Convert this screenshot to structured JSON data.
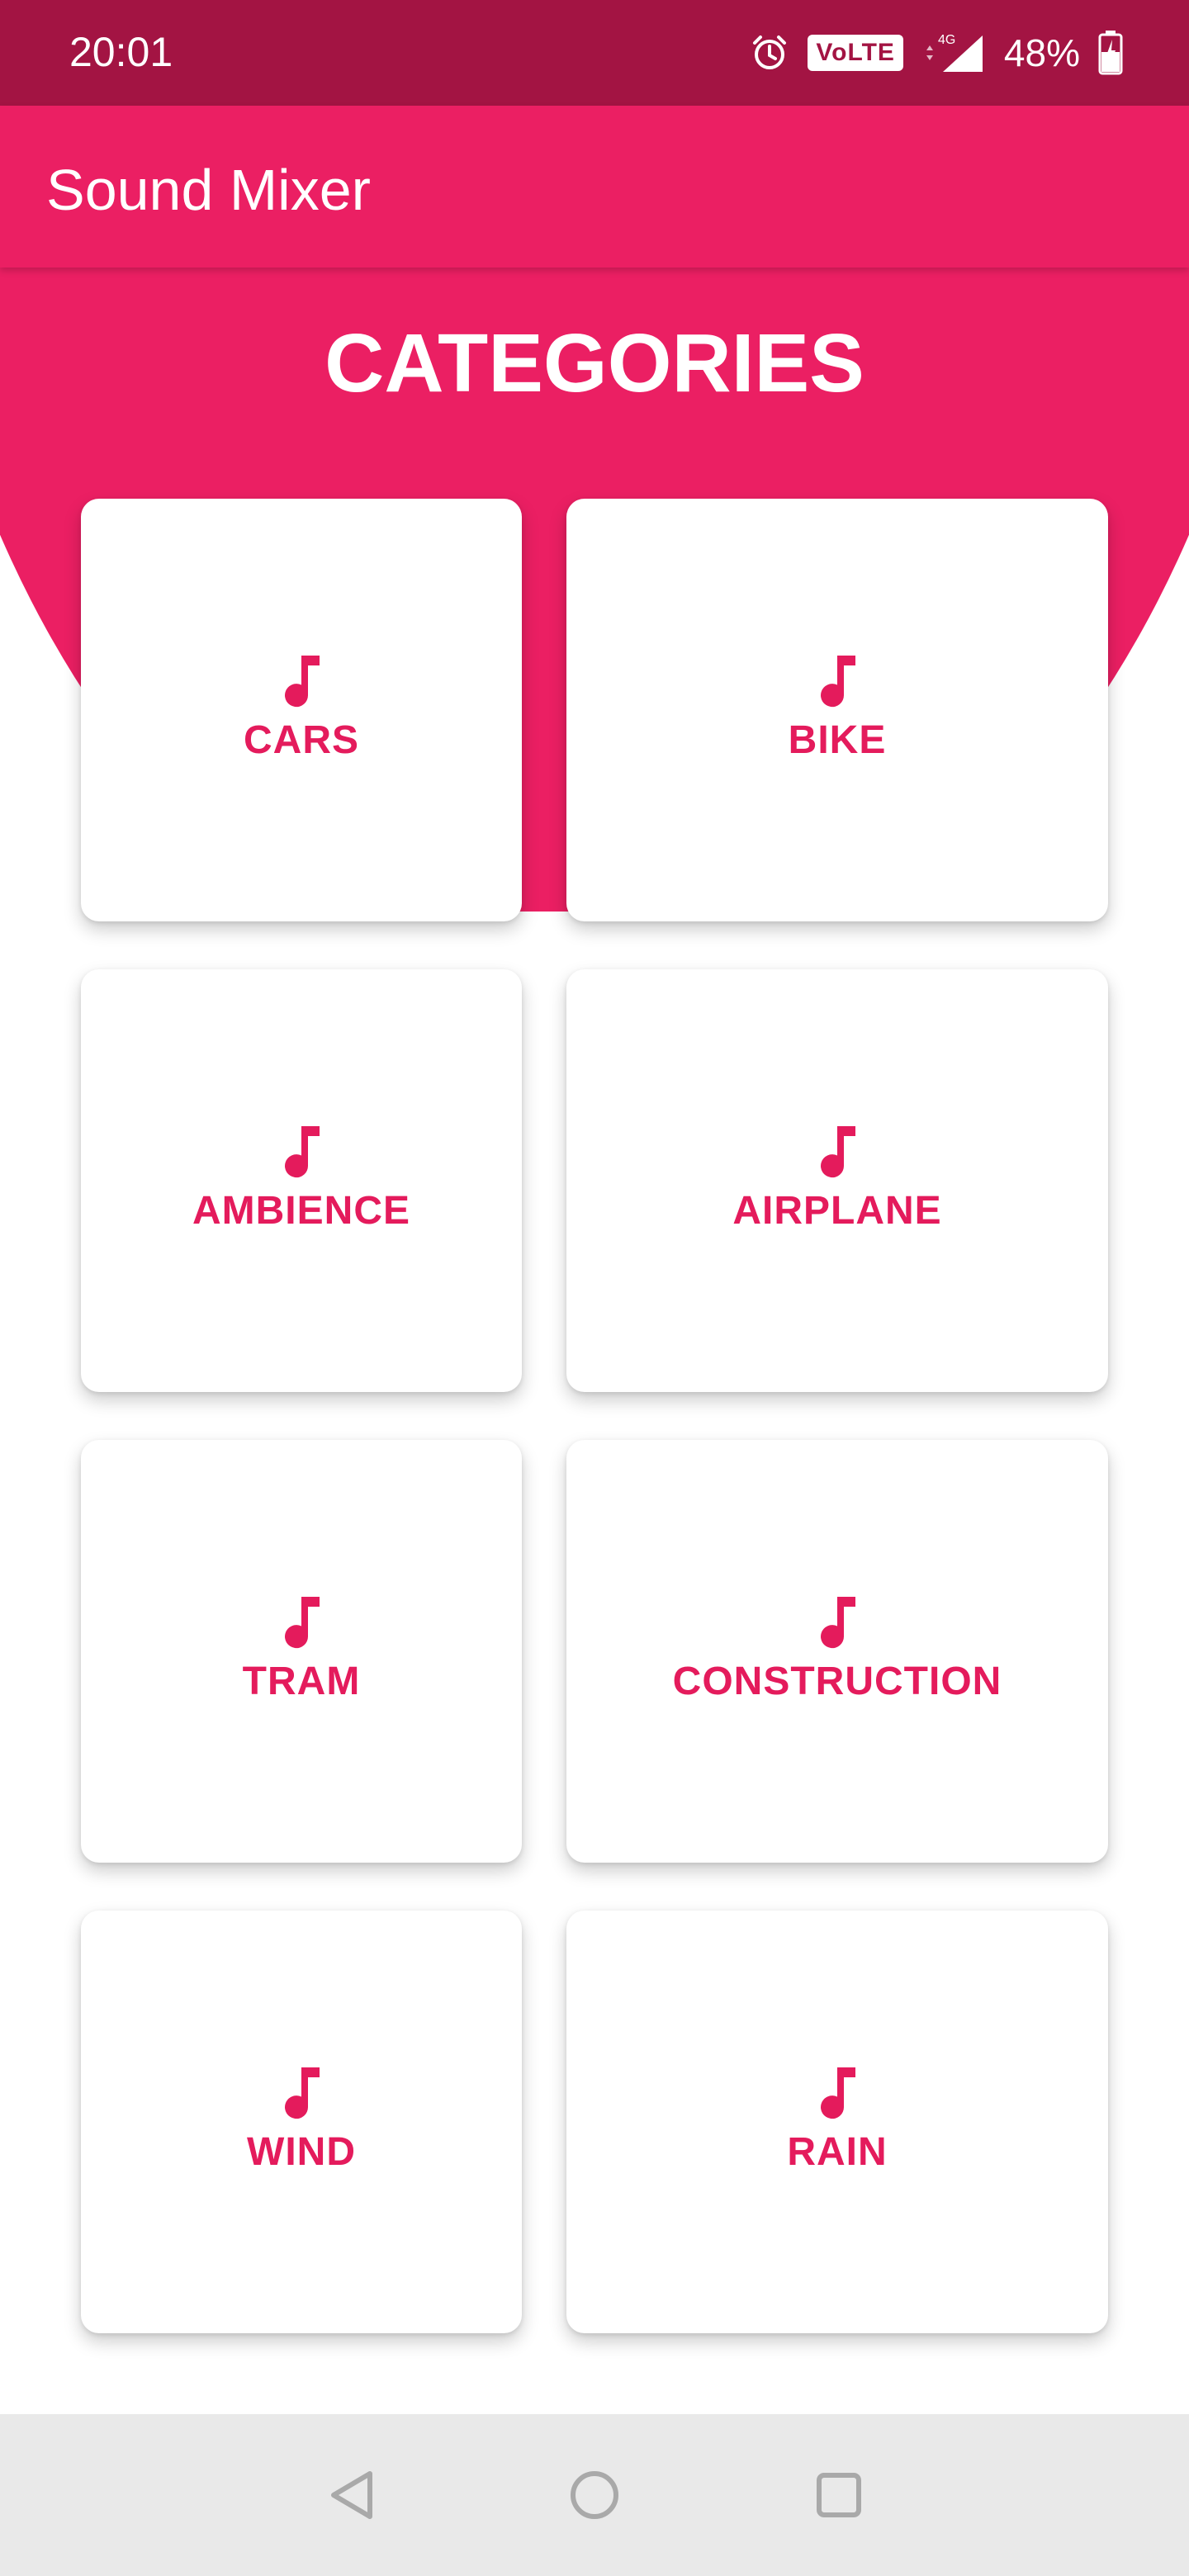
{
  "status_bar": {
    "time": "20:01",
    "volte_label": "VoLTE",
    "network_label": "4G",
    "battery_percent": "48%"
  },
  "app_bar": {
    "title": "Sound Mixer"
  },
  "header": {
    "title": "CATEGORIES"
  },
  "categories": [
    {
      "label": "CARS",
      "icon": "music-note-icon"
    },
    {
      "label": "BIKE",
      "icon": "music-note-icon"
    },
    {
      "label": "AMBIENCE",
      "icon": "music-note-icon"
    },
    {
      "label": "AIRPLANE",
      "icon": "music-note-icon"
    },
    {
      "label": "TRAM",
      "icon": "music-note-icon"
    },
    {
      "label": "CONSTRUCTION",
      "icon": "music-note-icon"
    },
    {
      "label": "WIND",
      "icon": "music-note-icon"
    },
    {
      "label": "RAIN",
      "icon": "music-note-icon"
    }
  ],
  "nav_bar": {
    "buttons": [
      "back-icon",
      "home-icon",
      "recents-icon"
    ]
  },
  "colors": {
    "status_bar": "#a31443",
    "primary": "#eb1f63",
    "accent_text": "#e41b5c",
    "nav_bar": "#e9e9e9"
  }
}
